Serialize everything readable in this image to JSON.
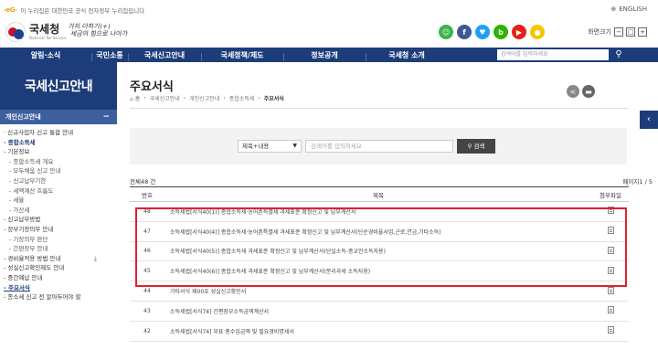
{
  "util": {
    "gov_badge": "-eG-",
    "gov_text": "이 누리집은 대한민국 공식 전자정부 누리집입니다",
    "english": "ENGLISH"
  },
  "logo": {
    "name": "국세청",
    "sub": "National Tax Service",
    "slogan_line1": "가치 더하기(+)",
    "slogan_line2": "세금의 힘으로 나아가"
  },
  "sns": [
    {
      "icon": "talk-icon",
      "glyph": "☺",
      "color": "#3cb44b"
    },
    {
      "icon": "facebook-icon",
      "glyph": "f",
      "color": "#3b5998"
    },
    {
      "icon": "twitter-icon",
      "glyph": "♥",
      "color": "#1da1f2"
    },
    {
      "icon": "blog-icon",
      "glyph": "b",
      "color": "#2db400"
    },
    {
      "icon": "youtube-icon",
      "glyph": "▶",
      "color": "#e62117"
    },
    {
      "icon": "kakao-icon",
      "glyph": "●",
      "color": "#f7c600"
    }
  ],
  "zoom": {
    "label": "화면크기",
    "minus": "−",
    "reset": "□",
    "plus": "+"
  },
  "gnb": {
    "items": [
      "알림·소식",
      "국민소통",
      "국세신고안내",
      "국세정책/제도",
      "정보공개",
      "국세청 소개"
    ],
    "search_placeholder": "검색어를 입력하세요"
  },
  "lnb": {
    "title": "국세신고안내",
    "section": "개인신고안내",
    "items": [
      {
        "label": "· 신규사업자 신고 통합 안내",
        "level": 1
      },
      {
        "label": "· 종합소득세",
        "level": 1,
        "on": true
      },
      {
        "label": "- 기본정보",
        "level": 1
      },
      {
        "label": "- 종합소득세 개요",
        "level": 2
      },
      {
        "label": "- 모두채움 신고 안내",
        "level": 2
      },
      {
        "label": "- 신고납부기한",
        "level": 2
      },
      {
        "label": "- 세액계산 흐름도",
        "level": 2
      },
      {
        "label": "- 세율",
        "level": 2
      },
      {
        "label": "- 가산세",
        "level": 2
      },
      {
        "label": "- 신고납부방법",
        "level": 1
      },
      {
        "label": "- 장부기장의무 안내",
        "level": 1
      },
      {
        "label": "- 기장의무 판단",
        "level": 2
      },
      {
        "label": "- 간편장부 안내",
        "level": 2
      },
      {
        "label": "- 경비율적용 방법 안내",
        "level": 1,
        "download": "⤓"
      },
      {
        "label": "- 성실신고확인제도 안내",
        "level": 1
      },
      {
        "label": "- 중간예납 안내",
        "level": 1
      },
      {
        "label": "- 주요서식",
        "level": 1,
        "on": true,
        "underline": true
      },
      {
        "label": "- 종소세 신고 전 알아두어야 할",
        "level": 1
      }
    ]
  },
  "page": {
    "title": "주요서식",
    "breadcrumb": [
      "⌂ 홈",
      "국세신고안내",
      "개인신고안내",
      "종합소득세",
      "주요서식"
    ]
  },
  "search": {
    "select_value": "제목+내용",
    "input_placeholder": "검색어를 입력하세요",
    "button_label": "검색"
  },
  "list": {
    "total_label": "전체48 건",
    "page_label": "페이지1 / 5",
    "headers": [
      "번호",
      "제목",
      "첨부파일"
    ],
    "rows": [
      {
        "no": "48",
        "title": "소득세법[서식40(1)] 종합소득세·농어촌특별세 과세표준 확정신고 및 납부계산서"
      },
      {
        "no": "47",
        "title": "소득세법[서식40(4)] 종합소득세·농어촌특별세 과세표준 확정신고 및 납부계산서(단순경비율사업,근로,연금,기타소득)"
      },
      {
        "no": "46",
        "title": "소득세법[서식40(5)] 종합소득세 과세표준 확정신고 및 납부계산서(단일소득-종교인소득자용)"
      },
      {
        "no": "45",
        "title": "소득세법[서식40(6)] 종합소득세 과세표준 확정신고 및 납부계산서(분리과세 소득자용)"
      },
      {
        "no": "44",
        "title": "기타서식 제00호 성실신고확인서"
      },
      {
        "no": "43",
        "title": "소득세법[서식74] 간편장부소득금액계산서"
      },
      {
        "no": "42",
        "title": "소득세법[서식74] 부표 총수입금액 및 필요경비명세서"
      }
    ]
  }
}
